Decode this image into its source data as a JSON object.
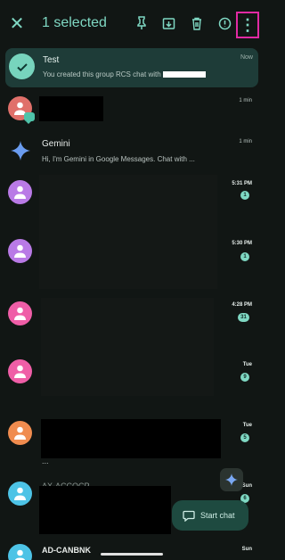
{
  "topbar": {
    "title": "1 selected",
    "icons": [
      "close-icon",
      "pin-icon",
      "archive-icon",
      "delete-icon",
      "block-icon",
      "more-vert-icon"
    ]
  },
  "selected": {
    "name": "Test",
    "snippet": "You created this group RCS chat with",
    "time": "Now"
  },
  "conversations": [
    {
      "avatar_color": "#e0706a",
      "time": "1 min"
    },
    {
      "name": "Gemini",
      "snippet": "Hi, I'm Gemini in Google Messages. Chat with ...",
      "time": "1 min"
    },
    {
      "avatar_color": "#b97ae6",
      "time": "5:31 PM",
      "unread": "1"
    },
    {
      "avatar_color": "#b97ae6",
      "time": "5:30 PM",
      "unread": "1"
    },
    {
      "avatar_color": "#ef5ea7",
      "time": "4:28 PM",
      "unread": "31"
    },
    {
      "avatar_color": "#ef5ea7",
      "time": "Tue",
      "unread": "9"
    },
    {
      "avatar_color": "#f08c4f",
      "time": "Tue",
      "unread": "5",
      "snippet": "..."
    },
    {
      "avatar_color": "#4dc3e6",
      "time": "Sun",
      "unread": "6",
      "name": "AX-ACCOCP"
    },
    {
      "avatar_color": "#4dc3e6",
      "name": "AD-CANBNK",
      "time": "Sun"
    }
  ],
  "start_chat": {
    "label": "Start chat"
  }
}
